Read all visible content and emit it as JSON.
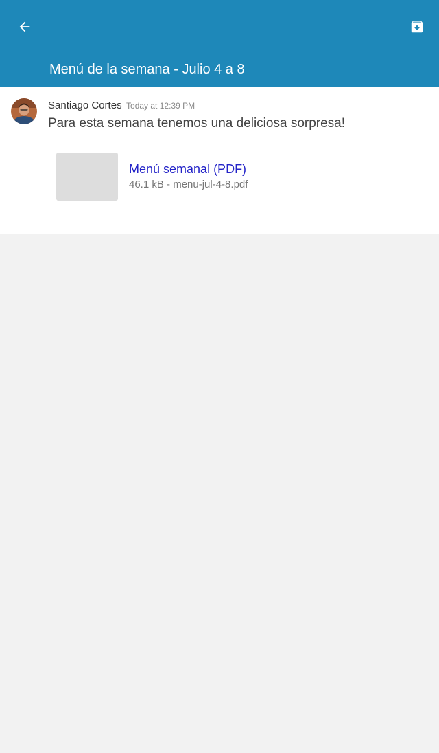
{
  "header": {
    "title": "Menú de la semana - Julio 4 a 8",
    "back_icon": "arrow-left-icon",
    "archive_icon": "archive-download-icon",
    "background_color": "#1e88b9"
  },
  "message": {
    "author": "Santiago Cortes",
    "timestamp": "Today at 12:39 PM",
    "body": "Para esta semana tenemos una deliciosa sorpresa!",
    "attachment": {
      "title": "Menú semanal (PDF)",
      "meta": "46.1 kB - menu-jul-4-8.pdf",
      "title_color": "#2424c8"
    }
  }
}
